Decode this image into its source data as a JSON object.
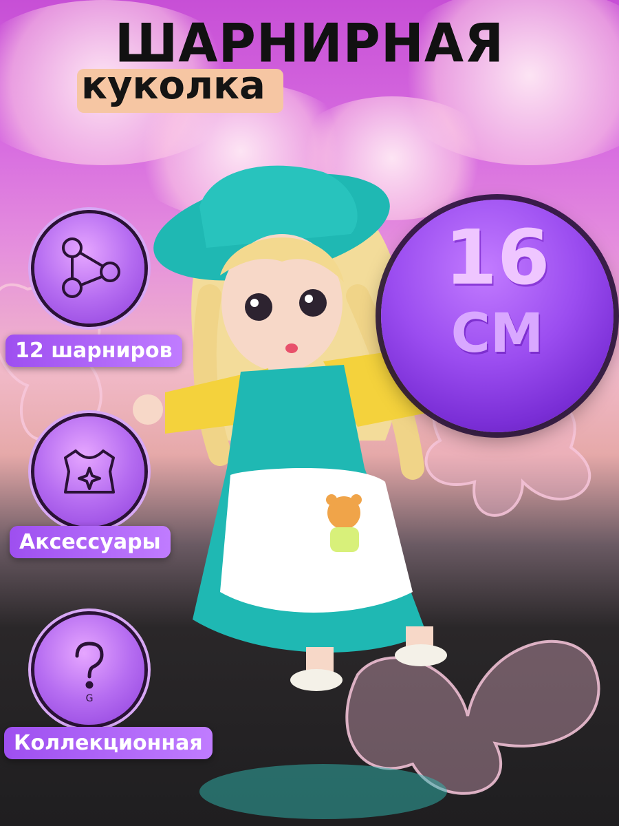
{
  "title": {
    "main": "ШАРНИРНАЯ",
    "sub": "куколка"
  },
  "size": {
    "number": "16",
    "unit": "СМ"
  },
  "features": [
    {
      "label": "12 шарниров",
      "icon": "joints-icon"
    },
    {
      "label": "Аксессуары",
      "icon": "dress-icon"
    },
    {
      "label": "Коллекционная",
      "icon": "question-icon"
    }
  ],
  "colors": {
    "accent": "#a455f0",
    "badge": "#f6c6a3",
    "title": "#111111"
  }
}
